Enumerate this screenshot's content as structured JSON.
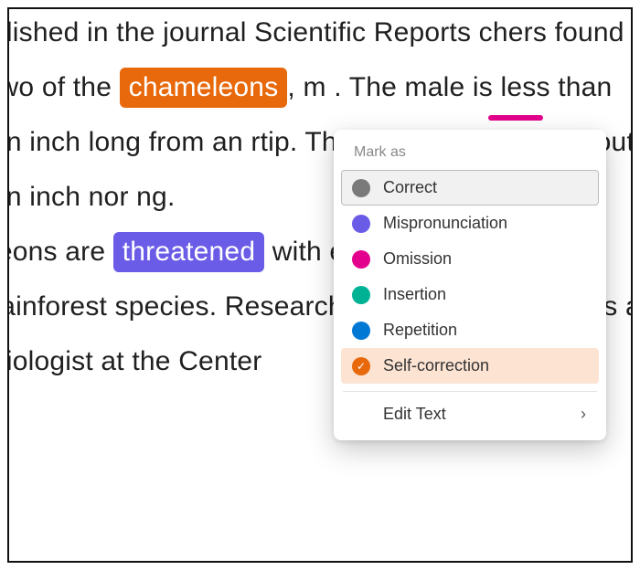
{
  "passage": {
    "pre1": "blished in the journal Scientific Reports chers found two of the ",
    "hl1": "chameleons",
    "post1": ", m",
    "line2": ". The male is less than an inch long from an ",
    "line3": "rtip. The female is larger, about an inch nor ",
    "line4": "ng.",
    "line5a": "leons are ",
    "hl2": "threatened",
    "line5b": " with extinction ion ",
    "line6": "many rainforest species. Researchers is g ",
    "line7": "Hawlitschek is a biologist at the Center"
  },
  "popup": {
    "title": "Mark as",
    "items": [
      {
        "label": "Correct",
        "color": "#7a7a7a"
      },
      {
        "label": "Mispronunciation",
        "color": "#6b5ce7"
      },
      {
        "label": "Omission",
        "color": "#e3008c"
      },
      {
        "label": "Insertion",
        "color": "#00b294"
      },
      {
        "label": "Repetition",
        "color": "#0078d4"
      },
      {
        "label": "Self-correction",
        "color": "#e8690b"
      }
    ],
    "edit_label": "Edit Text"
  },
  "colors": {
    "highlight_orange": "#e8690b",
    "highlight_purple": "#6b5ce7",
    "omission_pink": "#e3008c"
  }
}
